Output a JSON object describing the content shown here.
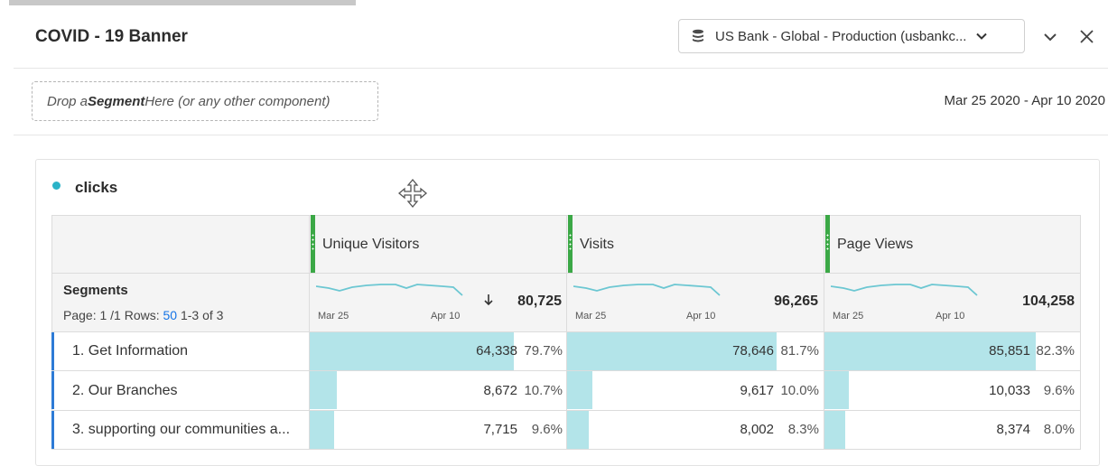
{
  "header": {
    "title": "COVID - 19 Banner",
    "data_source": "US Bank - Global - Production (usbankc...",
    "date_range": "Mar 25 2020 - Apr 10 2020"
  },
  "drop_zone": {
    "prefix": "Drop a ",
    "bold": "Segment",
    "suffix": " Here (or any other component)"
  },
  "visualization": {
    "title": "clicks",
    "dot_color": "#2bb3c8",
    "segments_label": "Segments",
    "pagination": {
      "page": "Page: 1 /1",
      "rows_label": "Rows:",
      "rows_value": "50",
      "range": "1-3 of 3"
    },
    "metrics": [
      {
        "name": "Unique Visitors",
        "total": "80,725",
        "start_date": "Mar 25",
        "end_date": "Apr 10",
        "sorted": true
      },
      {
        "name": "Visits",
        "total": "96,265",
        "start_date": "Mar 25",
        "end_date": "Apr 10",
        "sorted": false
      },
      {
        "name": "Page Views",
        "total": "104,258",
        "start_date": "Mar 25",
        "end_date": "Apr 10",
        "sorted": false
      }
    ],
    "rows": [
      {
        "label": "1. Get Information",
        "cells": [
          {
            "value": "64,338",
            "pct": "79.7%",
            "fill": 0.797
          },
          {
            "value": "78,646",
            "pct": "81.7%",
            "fill": 0.817
          },
          {
            "value": "85,851",
            "pct": "82.3%",
            "fill": 0.823
          }
        ]
      },
      {
        "label": "2. Our Branches",
        "cells": [
          {
            "value": "8,672",
            "pct": "10.7%",
            "fill": 0.107
          },
          {
            "value": "9,617",
            "pct": "10.0%",
            "fill": 0.1
          },
          {
            "value": "10,033",
            "pct": "9.6%",
            "fill": 0.096
          }
        ]
      },
      {
        "label": "3. supporting our communities a...",
        "cells": [
          {
            "value": "7,715",
            "pct": "9.6%",
            "fill": 0.096
          },
          {
            "value": "8,002",
            "pct": "8.3%",
            "fill": 0.083
          },
          {
            "value": "8,374",
            "pct": "8.0%",
            "fill": 0.08
          }
        ]
      }
    ],
    "colors": {
      "bar_fill": "#b3e4e9",
      "metric_grip": "#3ba846",
      "row_marker": "#2d7bd6",
      "sparkline": "#6cc7d2",
      "rows_link": "#1473e6"
    },
    "icons": [
      "database-icon",
      "chevron-down-icon",
      "close-icon",
      "move-icon",
      "sort-descending-icon"
    ]
  }
}
